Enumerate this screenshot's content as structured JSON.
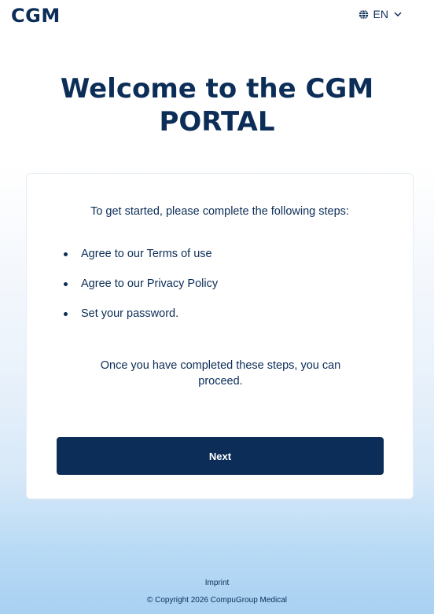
{
  "header": {
    "logo_text": "CGM",
    "language": "EN",
    "language_icon": "globe-icon",
    "dropdown_icon": "chevron-down-icon"
  },
  "welcome": {
    "title_line1": "Welcome to the CGM",
    "title_line2": "PORTAL"
  },
  "card": {
    "intro": "To get started, please complete the following steps:",
    "steps": [
      "Agree to our Terms of use",
      "Agree to our Privacy Policy",
      "Set your password."
    ],
    "outro_line1": "Once you have completed these steps, you can",
    "outro_line2": "proceed.",
    "next_label": "Next"
  },
  "footer": {
    "imprint": "Imprint",
    "copyright": "© Copyright 2026 CompuGroup Medical"
  },
  "colors": {
    "brand_navy": "#0b2d57",
    "background_gradient_bottom": "#a9d1f2"
  }
}
